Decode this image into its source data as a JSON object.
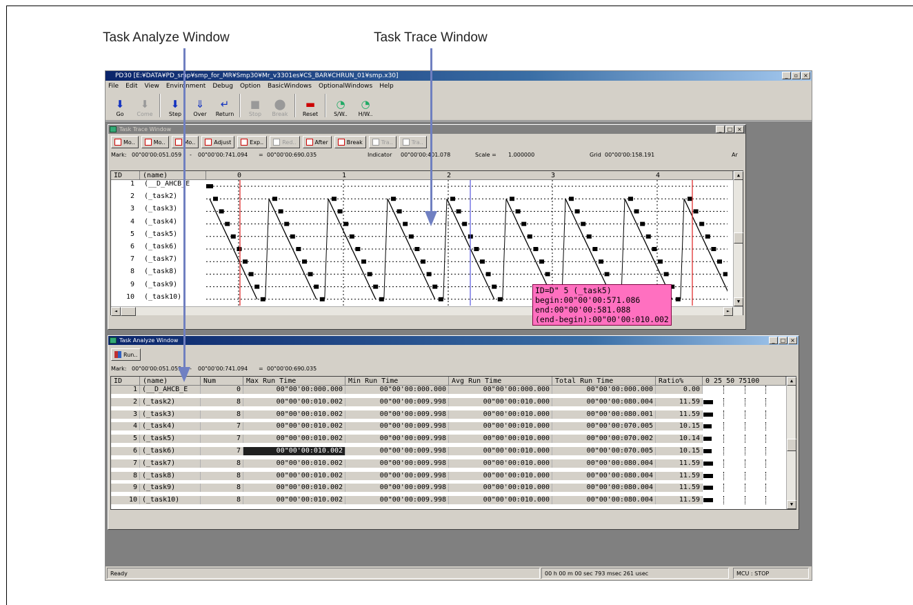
{
  "captions": {
    "analyze": "Task Analyze Window",
    "trace": "Task Trace Window"
  },
  "app": {
    "title": "PD30 [E:¥DATA¥PD_smp¥smp_for_MR¥Smp30¥Mr_v3301es¥CS_BAR¥CHRUN_01¥smp.x30]",
    "menu": [
      "File",
      "Edit",
      "View",
      "Environment",
      "Debug",
      "Option",
      "BasicWindows",
      "OptionalWindows",
      "Help"
    ],
    "toolbar": [
      {
        "label": "Go",
        "icon": "go-icon",
        "glyph": "⬇",
        "color": "#1030c0",
        "enabled": true
      },
      {
        "label": "Come",
        "icon": "come-icon",
        "glyph": "⬇",
        "color": "#999",
        "enabled": false
      },
      {
        "label": "Step",
        "icon": "step-icon",
        "glyph": "⬇",
        "color": "#1030c0",
        "enabled": true
      },
      {
        "label": "Over",
        "icon": "over-icon",
        "glyph": "⇓",
        "color": "#1030c0",
        "enabled": true
      },
      {
        "label": "Return",
        "icon": "return-icon",
        "glyph": "↵",
        "color": "#1030c0",
        "enabled": true
      },
      {
        "label": "Stop",
        "icon": "stop-icon",
        "glyph": "■",
        "color": "#999",
        "enabled": false
      },
      {
        "label": "Break",
        "icon": "break-icon",
        "glyph": "⬤",
        "color": "#999",
        "enabled": false
      },
      {
        "label": "Reset",
        "icon": "reset-icon",
        "glyph": "▬",
        "color": "#c00",
        "enabled": true
      },
      {
        "label": "S/W..",
        "icon": "sw-break-icon",
        "glyph": "◔",
        "color": "#2a6",
        "enabled": true
      },
      {
        "label": "H/W..",
        "icon": "hw-break-icon",
        "glyph": "◔",
        "color": "#2a6",
        "enabled": true
      }
    ],
    "status": {
      "left": "Ready",
      "time": "00 h 00 m 00 sec 793 msec 261 usec",
      "mcu": "MCU : STOP"
    }
  },
  "trace": {
    "title": "Task Trace Window",
    "buttons": [
      {
        "label": "Mo..",
        "enabled": true
      },
      {
        "label": "Mo..",
        "enabled": true
      },
      {
        "label": "Mo..",
        "enabled": true
      },
      {
        "label": "Adjust",
        "enabled": true
      },
      {
        "label": "Exp..",
        "enabled": true
      },
      {
        "label": "Red..",
        "enabled": false
      },
      {
        "label": "After",
        "enabled": true
      },
      {
        "label": "Break",
        "enabled": true
      },
      {
        "label": "Tra..",
        "enabled": false
      },
      {
        "label": "Tra..",
        "enabled": false
      }
    ],
    "mark": {
      "label": "Mark:",
      "start": "00\"00'00:051.059",
      "sep1": "-",
      "end": "00\"00'00:741.094",
      "sep2": "=",
      "diff": "00\"00'00:690.035",
      "indicator_label": "Indicator",
      "indicator": "00\"00'00:401.078",
      "scale_label": "Scale =",
      "scale": "1.000000",
      "grid_label": "Grid",
      "grid": "00\"00'00:158.191",
      "tail": "Ar"
    },
    "headers": {
      "id": "ID",
      "name": "(name)"
    },
    "ticks": [
      "0",
      "1",
      "2",
      "3",
      "4"
    ],
    "tasks": [
      {
        "id": "1",
        "name": "(__D_AHCB_E"
      },
      {
        "id": "2",
        "name": "(_task2)"
      },
      {
        "id": "3",
        "name": "(_task3)"
      },
      {
        "id": "4",
        "name": "(_task4)"
      },
      {
        "id": "5",
        "name": "(_task5)"
      },
      {
        "id": "6",
        "name": "(_task6)"
      },
      {
        "id": "7",
        "name": "(_task7)"
      },
      {
        "id": "8",
        "name": "(_task8)"
      },
      {
        "id": "9",
        "name": "(_task9)"
      },
      {
        "id": "10",
        "name": "(_task10)"
      }
    ],
    "tooltip": [
      "ID=D\"  5 (_task5)",
      "begin:00\"00'00:571.086",
      "end:00\"00'00:581.088",
      "(end-begin):00\"00'00:010.002"
    ]
  },
  "analyze": {
    "title": "Task Analyze Window",
    "button": "Run..",
    "mark": {
      "label": "Mark:",
      "start": "00\"00'00:051.059",
      "sep1": "-",
      "end": "00\"00'00:741.094",
      "sep2": "=",
      "diff": "00\"00'00:690.035"
    },
    "headers": [
      "ID",
      "(name)",
      "Num",
      "Max Run Time",
      "Min Run Time",
      "Avg Run Time",
      "Total Run Time",
      "Ratio%",
      "0  25  50  75100"
    ],
    "rows": [
      {
        "id": "1",
        "name": "(__D_AHCB_E",
        "num": "0",
        "max": "00\"00'00:000.000",
        "min": "00\"00'00:000.000",
        "avg": "00\"00'00:000.000",
        "total": "00\"00'00:000.000",
        "ratio": "0.00",
        "ratio_value": 0.0
      },
      {
        "id": "2",
        "name": "(_task2)",
        "num": "8",
        "max": "00\"00'00:010.002",
        "min": "00\"00'00:009.998",
        "avg": "00\"00'00:010.000",
        "total": "00\"00'00:080.004",
        "ratio": "11.59",
        "ratio_value": 11.59
      },
      {
        "id": "3",
        "name": "(_task3)",
        "num": "8",
        "max": "00\"00'00:010.002",
        "min": "00\"00'00:009.998",
        "avg": "00\"00'00:010.000",
        "total": "00\"00'00:080.001",
        "ratio": "11.59",
        "ratio_value": 11.59
      },
      {
        "id": "4",
        "name": "(_task4)",
        "num": "7",
        "max": "00\"00'00:010.002",
        "min": "00\"00'00:009.998",
        "avg": "00\"00'00:010.000",
        "total": "00\"00'00:070.005",
        "ratio": "10.15",
        "ratio_value": 10.15
      },
      {
        "id": "5",
        "name": "(_task5)",
        "num": "7",
        "max": "00\"00'00:010.002",
        "min": "00\"00'00:009.998",
        "avg": "00\"00'00:010.000",
        "total": "00\"00'00:070.002",
        "ratio": "10.14",
        "ratio_value": 10.14
      },
      {
        "id": "6",
        "name": "(_task6)",
        "num": "7",
        "max": "00\"00'00:010.002",
        "min": "00\"00'00:009.998",
        "avg": "00\"00'00:010.000",
        "total": "00\"00'00:070.005",
        "ratio": "10.15",
        "ratio_value": 10.15,
        "selected_max": true
      },
      {
        "id": "7",
        "name": "(_task7)",
        "num": "8",
        "max": "00\"00'00:010.002",
        "min": "00\"00'00:009.998",
        "avg": "00\"00'00:010.000",
        "total": "00\"00'00:080.004",
        "ratio": "11.59",
        "ratio_value": 11.59
      },
      {
        "id": "8",
        "name": "(_task8)",
        "num": "8",
        "max": "00\"00'00:010.002",
        "min": "00\"00'00:009.998",
        "avg": "00\"00'00:010.000",
        "total": "00\"00'00:080.004",
        "ratio": "11.59",
        "ratio_value": 11.59
      },
      {
        "id": "9",
        "name": "(_task9)",
        "num": "8",
        "max": "00\"00'00:010.002",
        "min": "00\"00'00:009.998",
        "avg": "00\"00'00:010.000",
        "total": "00\"00'00:080.004",
        "ratio": "11.59",
        "ratio_value": 11.59
      },
      {
        "id": "10",
        "name": "(_task10)",
        "num": "8",
        "max": "00\"00'00:010.002",
        "min": "00\"00'00:009.998",
        "avg": "00\"00'00:010.000",
        "total": "00\"00'00:080.004",
        "ratio": "11.59",
        "ratio_value": 11.59
      }
    ]
  },
  "colors": {
    "title_active": "#0a246a",
    "tooltip": "#ff70c0",
    "marker_red": "#e03030",
    "marker_blue": "#6060e0",
    "arrow": "#6f7fc0"
  }
}
